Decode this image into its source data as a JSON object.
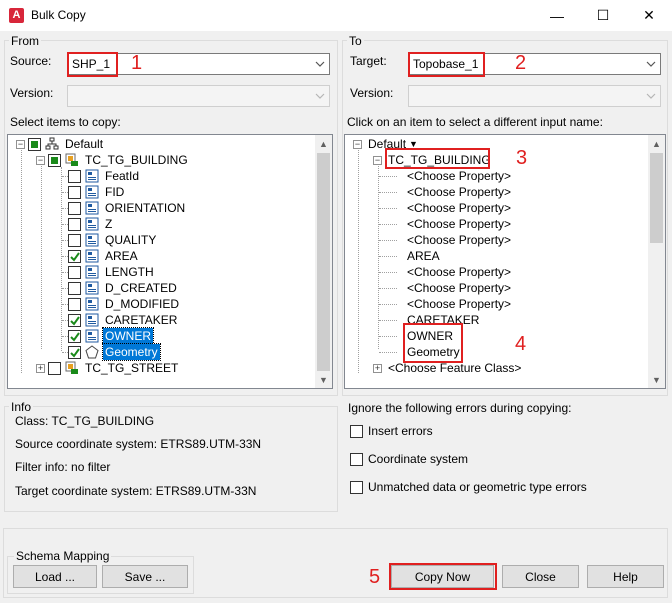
{
  "window": {
    "app_icon_letter": "A",
    "title": "Bulk Copy",
    "minimize": "—",
    "maximize": "☐",
    "close": "✕"
  },
  "from": {
    "group_label": "From",
    "source_label": "Source:",
    "source_value": "SHP_1",
    "version_label": "Version:",
    "select_label": "Select items to copy:",
    "tree": {
      "root": "Default",
      "feature_class": "TC_TG_BUILDING",
      "attributes": [
        {
          "label": "FeatId",
          "checked": false
        },
        {
          "label": "FID",
          "checked": false
        },
        {
          "label": "ORIENTATION",
          "checked": false
        },
        {
          "label": "Z",
          "checked": false
        },
        {
          "label": "QUALITY",
          "checked": false
        },
        {
          "label": "AREA",
          "checked": true
        },
        {
          "label": "LENGTH",
          "checked": false
        },
        {
          "label": "D_CREATED",
          "checked": false
        },
        {
          "label": "D_MODIFIED",
          "checked": false
        },
        {
          "label": "CARETAKER",
          "checked": true
        },
        {
          "label": "OWNER",
          "checked": true,
          "selected": true
        },
        {
          "label": "Geometry",
          "checked": true,
          "selected": true
        }
      ],
      "next_class": "TC_TG_STREET"
    }
  },
  "to": {
    "group_label": "To",
    "target_label": "Target:",
    "target_value": "Topobase_1",
    "version_label": "Version:",
    "click_label": "Click on an item to select a different input name:",
    "tree": {
      "root": "Default",
      "feature_class": "TC_TG_BUILDING",
      "mappings": [
        "<Choose Property>",
        "<Choose Property>",
        "<Choose Property>",
        "<Choose Property>",
        "<Choose Property>",
        "AREA",
        "<Choose Property>",
        "<Choose Property>",
        "<Choose Property>",
        "CARETAKER",
        "OWNER",
        "Geometry"
      ],
      "next_class": "<Choose Feature Class>"
    }
  },
  "info": {
    "group_label": "Info",
    "class_line": "Class: TC_TG_BUILDING",
    "source_cs": "Source coordinate system: ETRS89.UTM-33N",
    "filter_info": "Filter info: no filter",
    "target_cs": "Target coordinate system: ETRS89.UTM-33N"
  },
  "errors": {
    "label": "Ignore the following errors during copying:",
    "options": [
      "Insert errors",
      "Coordinate system",
      "Unmatched data or geometric type errors"
    ]
  },
  "schema": {
    "group_label": "Schema Mapping",
    "load": "Load ...",
    "save": "Save ..."
  },
  "buttons": {
    "copy_now": "Copy Now",
    "close": "Close",
    "help": "Help"
  },
  "annotations": [
    "1",
    "2",
    "3",
    "4",
    "5"
  ],
  "colors": {
    "annotation": "#e02020",
    "selection": "#0078d7",
    "check": "#1a8a1a"
  }
}
